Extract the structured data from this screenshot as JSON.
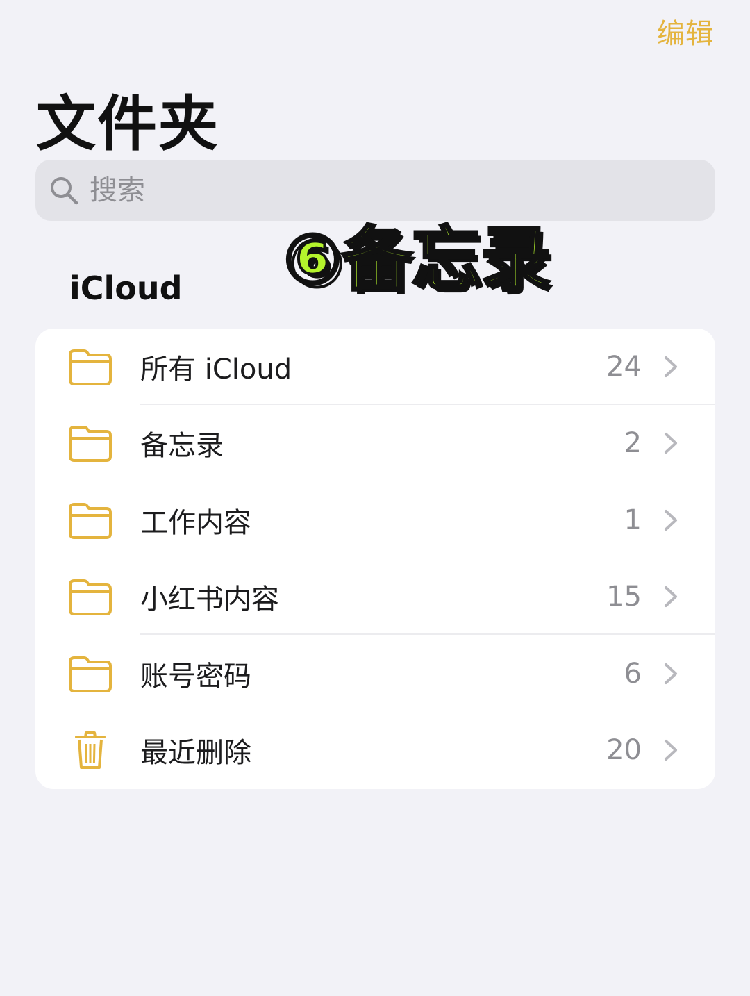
{
  "header": {
    "edit_label": "编辑",
    "title": "文件夹"
  },
  "search": {
    "placeholder": "搜索",
    "icon": "search-icon"
  },
  "overlay": {
    "text": "⑥备忘录",
    "fill_color": "#b4f32c",
    "outline_color": "#111111"
  },
  "sections": [
    {
      "header": "iCloud",
      "items": [
        {
          "label": "所有 iCloud",
          "count": "24",
          "icon": "folder-icon"
        },
        {
          "label": "备忘录",
          "count": "2",
          "icon": "folder-icon"
        },
        {
          "label": "工作内容",
          "count": "1",
          "icon": "folder-icon"
        },
        {
          "label": "小红书内容",
          "count": "15",
          "icon": "folder-icon"
        },
        {
          "label": "账号密码",
          "count": "6",
          "icon": "folder-icon"
        },
        {
          "label": "最近删除",
          "count": "20",
          "icon": "trash-icon"
        }
      ]
    }
  ],
  "colors": {
    "accent": "#e4b43e",
    "background": "#f2f2f7",
    "card": "#ffffff",
    "secondary_text": "#8e8e93"
  }
}
